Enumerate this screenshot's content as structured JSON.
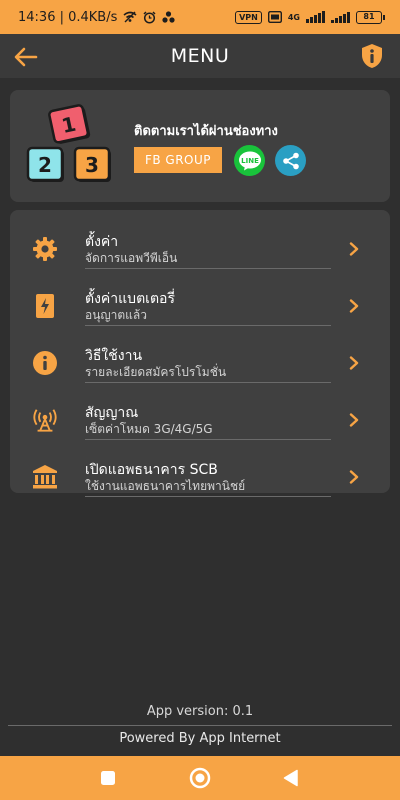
{
  "status_bar": {
    "time_speed": "14:36 | 0.4KB/s",
    "vpn": "VPN",
    "network": "4G",
    "battery": "81"
  },
  "app_bar": {
    "title": "MENU",
    "back_icon": "arrow-left-icon",
    "info_icon": "info-shield-icon"
  },
  "banner": {
    "logo_numbers": [
      "1",
      "2",
      "3"
    ],
    "follow_text": "ติดตามเราได้ผ่านช่องทาง",
    "fb_button": "FB GROUP",
    "line_label": "LINE",
    "share_icon": "share-icon"
  },
  "menu": {
    "items": [
      {
        "title": "ตั้งค่า",
        "subtitle": "จัดการแอพวีพีเอ็น",
        "icon": "gear-icon"
      },
      {
        "title": "ตั้งค่าแบตเตอรี่",
        "subtitle": "อนุญาตแล้ว",
        "icon": "battery-charging-icon"
      },
      {
        "title": "วิธีใช้งาน",
        "subtitle": "รายละเอียดสมัครโปรโมชั่น",
        "icon": "info-icon"
      },
      {
        "title": "สัญญาณ",
        "subtitle": "เซ็ตค่าโหมด 3G/4G/5G",
        "icon": "signal-tower-icon"
      },
      {
        "title": "เปิดแอพธนาคาร SCB",
        "subtitle": "ใช้งานแอพธนาคารไทยพานิชย์",
        "icon": "bank-icon"
      }
    ]
  },
  "footer": {
    "version": "App version: 0.1",
    "powered": "Powered By App Internet"
  },
  "colors": {
    "accent": "#f7a445",
    "background": "#2f2f2f",
    "card": "#404040",
    "line_green": "#19c33b",
    "share_blue": "#2a9fc3"
  }
}
